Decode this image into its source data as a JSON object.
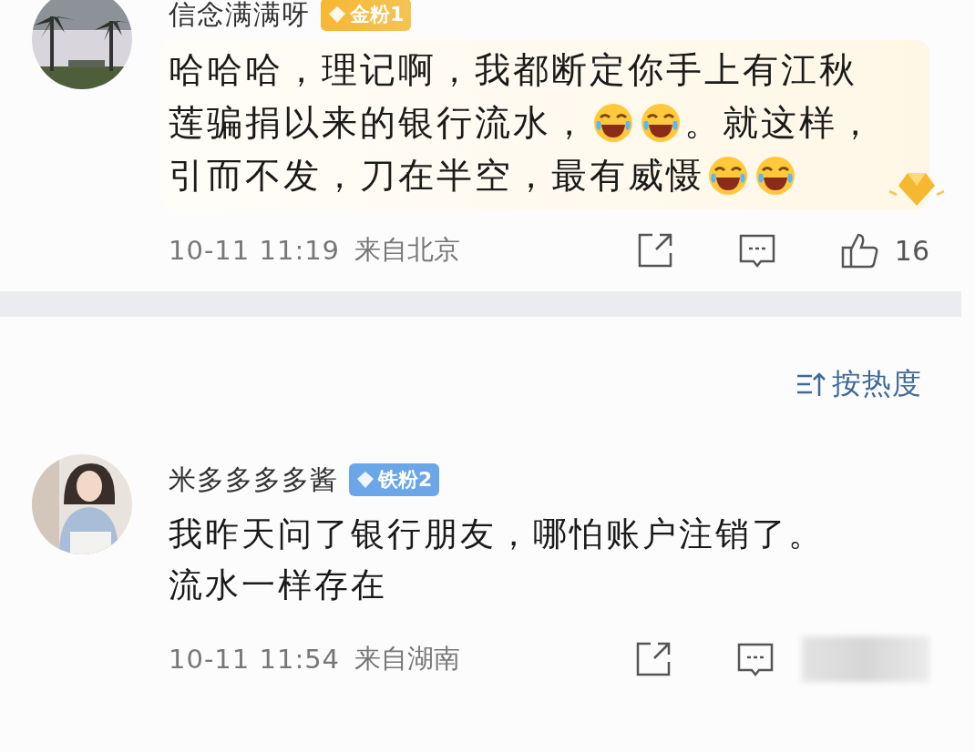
{
  "comments": [
    {
      "avatar": {
        "kind": "picture"
      },
      "name": "信念满满呀",
      "badge": {
        "text": "金粉1",
        "kind": "gold"
      },
      "highlighted": true,
      "lines": [
        [
          {
            "kind": "text",
            "text": "哈哈哈，理记啊，我都断定你手上有江秋"
          }
        ],
        [
          {
            "kind": "text",
            "text": "莲骗捐以来的银行流水，"
          },
          {
            "kind": "emoji"
          },
          {
            "kind": "emoji"
          },
          {
            "kind": "text",
            "text": "。就这样，"
          }
        ],
        [
          {
            "kind": "text",
            "text": "引而不发，刀在半空，最有威慑"
          },
          {
            "kind": "emoji"
          },
          {
            "kind": "emoji"
          }
        ]
      ],
      "time": "10-11 11:19",
      "location": "来自北京",
      "likes": "16"
    },
    {
      "sort": "按热度"
    },
    {
      "avatar": {
        "kind": "picture"
      },
      "name": "米多多多多酱",
      "badge": {
        "text": "铁粉2",
        "kind": "iron"
      },
      "highlighted": false,
      "lines": [
        [
          {
            "kind": "text",
            "text": "我昨天问了银行朋友，哪怕账户注销了。"
          }
        ],
        [
          {
            "kind": "text",
            "text": "流水一样存在"
          }
        ]
      ],
      "time": "10-11 11:54",
      "location": "来自湖南",
      "likes_hidden": true
    }
  ]
}
